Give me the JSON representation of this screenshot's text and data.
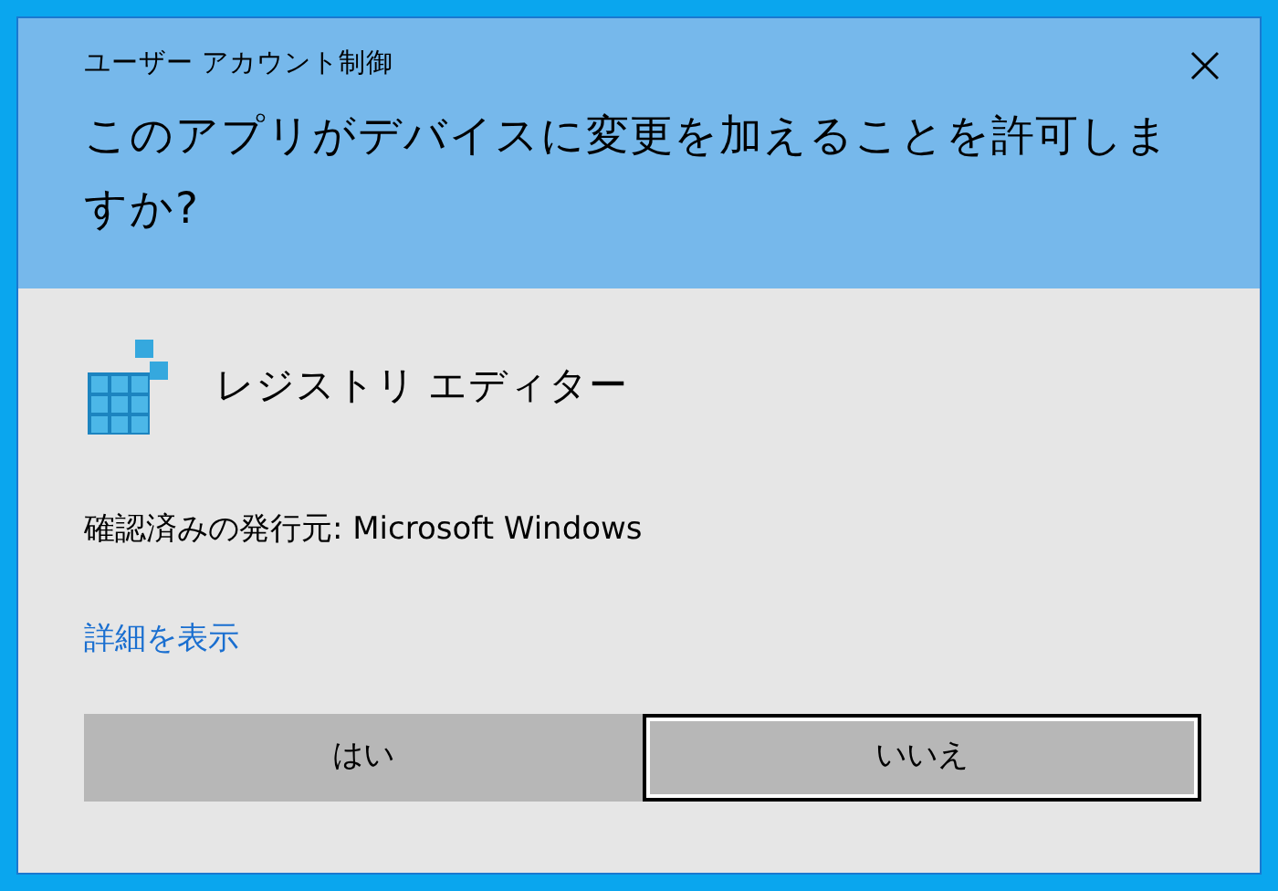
{
  "window": {
    "title": "ユーザー アカウント制御"
  },
  "question": "このアプリがデバイスに変更を加えることを許可しますか?",
  "app": {
    "name": "レジストリ エディター"
  },
  "publisher": "確認済みの発行元: Microsoft Windows",
  "details_link": "詳細を表示",
  "buttons": [
    {
      "label": "はい",
      "focused": false
    },
    {
      "label": "いいえ",
      "focused": true
    }
  ]
}
